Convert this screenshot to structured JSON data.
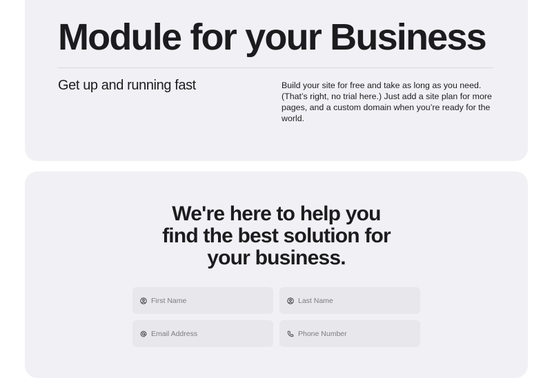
{
  "hero": {
    "title": "Module for your Business",
    "subhead": "Get up and running fast",
    "intro": "Build your site for free and take as long as you need. (That’s right, no trial here.) Just add a site plan for more pages, and a custom domain when you’re ready for the world."
  },
  "contact": {
    "title_line1": "We're here to help you",
    "title_line2": "find the best solution for",
    "title_line3": "your business.",
    "fields": [
      {
        "placeholder": "First Name",
        "icon": "user-icon"
      },
      {
        "placeholder": "Last Name",
        "icon": "user-icon"
      },
      {
        "placeholder": "Email Address",
        "icon": "at-icon"
      },
      {
        "placeholder": "Phone Number",
        "icon": "phone-icon"
      }
    ]
  },
  "colors": {
    "card_bg": "#f1f1f5",
    "field_bg": "#e7e7ec",
    "text": "#1c1c1e",
    "muted": "#7b7b82"
  }
}
